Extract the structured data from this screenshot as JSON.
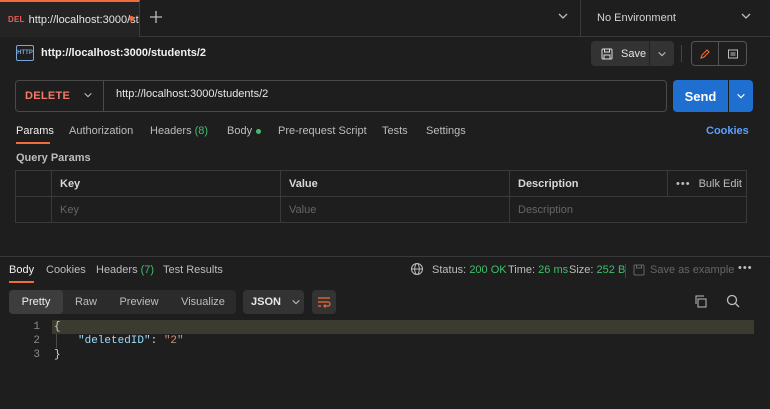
{
  "tab": {
    "method_tag": "DEL",
    "title": "http://localhost:3000/st"
  },
  "environment": {
    "label": "No Environment"
  },
  "request": {
    "icon_label": "HTTP",
    "title": "http://localhost:3000/students/2",
    "save_label": "Save",
    "method": "DELETE",
    "url": "http://localhost:3000/students/2",
    "send_label": "Send"
  },
  "request_tabs": {
    "params": "Params",
    "authorization": "Authorization",
    "headers": "Headers",
    "headers_count": "(8)",
    "body": "Body",
    "prerequest": "Pre-request Script",
    "tests": "Tests",
    "settings": "Settings",
    "cookies": "Cookies"
  },
  "query_params": {
    "title": "Query Params",
    "columns": {
      "key": "Key",
      "value": "Value",
      "description": "Description"
    },
    "bulk_edit": "Bulk Edit",
    "placeholders": {
      "key": "Key",
      "value": "Value",
      "description": "Description"
    }
  },
  "response_tabs": {
    "body": "Body",
    "cookies": "Cookies",
    "headers": "Headers",
    "headers_count": "(7)",
    "test_results": "Test Results"
  },
  "status": {
    "status_label": "Status:",
    "status_value": "200 OK",
    "time_label": "Time:",
    "time_value": "26 ms",
    "size_label": "Size:",
    "size_value": "252 B",
    "save_example": "Save as example"
  },
  "formats": {
    "pretty": "Pretty",
    "raw": "Raw",
    "preview": "Preview",
    "visualize": "Visualize",
    "json": "JSON"
  },
  "code": {
    "lines": [
      "1",
      "2",
      "3"
    ],
    "open": "{",
    "key": "\"deletedID\"",
    "colon": ": ",
    "value": "\"2\"",
    "close": "}"
  },
  "colors": {
    "accent": "#f26b3a",
    "send": "#1f6fd1",
    "success": "#3fbf6b",
    "delete_method": "#f27a6c"
  }
}
